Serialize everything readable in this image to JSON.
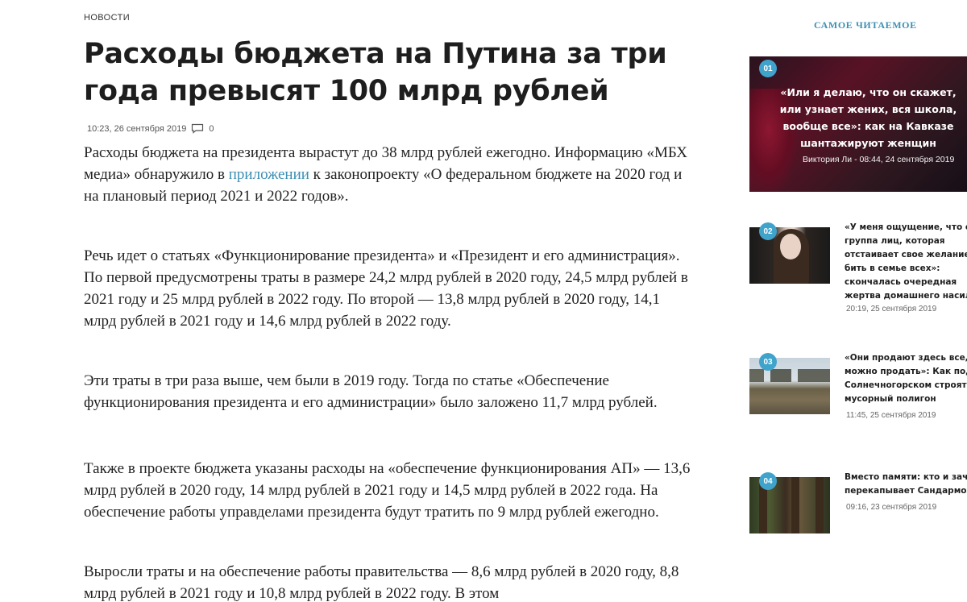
{
  "article": {
    "section": "НОВОСТИ",
    "title": "Расходы бюджета на Путина за три года превысят 100 млрд рублей",
    "timestamp": "10:23, 26 сентября 2019",
    "comments_count": "0",
    "p1_before": "Расходы бюджета на президента вырастут до 38 млрд рублей ежегодно. Информацию «МБХ медиа» обнаружило в ",
    "p1_link": "приложении",
    "p1_after": " к законопроекту «О федеральном бюджете на 2020 год и на плановый период 2021 и 2022 годов».",
    "p2": "Речь идет о статьях «Функционирование президента» и «Президент и его администрация». По первой предусмотрены траты в размере 24,2 млрд рублей в 2020 году, 24,5 млрд рублей в 2021 году и 25 млрд рублей в 2022 году. По второй — 13,8 млрд рублей в 2020 году, 14,1 млрд рублей в 2021 году и 14,6 млрд рублей в 2022 году.",
    "p3": "Эти траты в три раза выше, чем были в 2019 году. Тогда по статье «Обеспечение функционирования президента и его администрации» было заложено 11,7 млрд рублей.",
    "p4": "Также в проекте бюджета указаны расходы на «обеспечение функционирования АП» — 13,6 млрд рублей в 2020 году, 14 млрд рублей в 2021 году и 14,5 млрд рублей в 2022 года. На обеспечение работы управделами президента будут тратить по 9 млрд рублей ежегодно.",
    "p5": "Выросли траты и на обеспечение работы правительства — 8,6 млрд рублей в 2020 году, 8,8 млрд рублей в 2021 году и 10,8 млрд рублей в 2022 году. В этом"
  },
  "sidebar": {
    "heading": "САМОЕ ЧИТАЕМОЕ",
    "featured": {
      "number": "01",
      "title": "«Или я делаю, что он скажет, или узнает жених, вся школа, вообще все»: как на Кавказе шантажируют женщин",
      "meta": "Виктория Ли - 08:44, 24 сентября 2019"
    },
    "items": [
      {
        "number": "02",
        "lines": [
          "«У меня ощущение, что ес",
          "группа лиц, которая",
          "отстаивает свое желание",
          "бить в семье всех»:",
          "скончалась очередная",
          "жертва домашнего насил"
        ],
        "date": "20:19, 25 сентября 2019"
      },
      {
        "number": "03",
        "lines": [
          "«Они продают здесь все, ч",
          "можно продать»: Как под",
          "Солнечногорском строят",
          "мусорный полигон"
        ],
        "date": "11:45, 25 сентября 2019"
      },
      {
        "number": "04",
        "lines": [
          "Вместо памяти: кто и заче",
          "перекапывает Сандармох"
        ],
        "date": "09:16, 23 сентября 2019"
      }
    ]
  },
  "colors": {
    "accent": "#3d8fb3",
    "badge": "#3fa3cc",
    "link": "#3b8fb5"
  }
}
